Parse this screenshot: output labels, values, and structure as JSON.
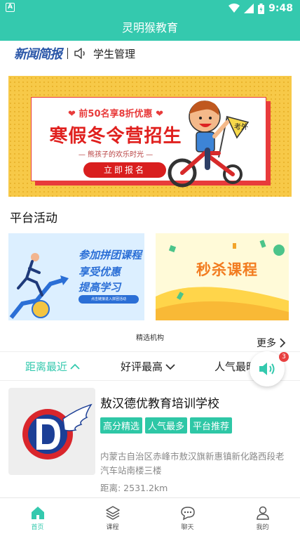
{
  "status_bar": {
    "notification_icon_letter": "A",
    "time": "9:48"
  },
  "app_bar": {
    "title": "灵明猴教育"
  },
  "news": {
    "logo_text": "新闻简报",
    "message": "学生管理"
  },
  "banner": {
    "discount": "❤ 前50名享8折优惠 ❤",
    "title": "寒假冬令营招生",
    "subtitle": "— 熊孩子的欢乐时光 —",
    "button": "立即报名",
    "flag_text": "考外"
  },
  "platform_activity": {
    "title": "平台活动",
    "promo_group": {
      "line1": "参加拼团课程",
      "line2": "享受优惠",
      "line3": "提高学习",
      "line4": "点击链接进入拼团活动"
    },
    "promo_flash": {
      "title": "秒杀课程"
    }
  },
  "featured": {
    "label": "精选机构",
    "more": "更多"
  },
  "filters": [
    {
      "label": "距离最近",
      "active": true
    },
    {
      "label": "好评最高",
      "active": false
    },
    {
      "label": "人气最旺",
      "active": false
    }
  ],
  "float_audio": {
    "badge": "3"
  },
  "school": {
    "name": "敖汉德优教育培训学校",
    "tags": [
      "高分精选",
      "人气最多",
      "平台推荐"
    ],
    "address": "内蒙古自治区赤峰市敖汉旗新惠镇新化路西段老汽车站南楼三楼",
    "distance": "距离: 2531.2km"
  },
  "bottom_nav": [
    {
      "label": "首页",
      "icon": "home-icon",
      "active": true
    },
    {
      "label": "课程",
      "icon": "layers-icon",
      "active": false
    },
    {
      "label": "聊天",
      "icon": "chat-icon",
      "active": false
    },
    {
      "label": "我的",
      "icon": "person-icon",
      "active": false
    }
  ],
  "colors": {
    "primary": "#34c9ae",
    "tag": "#2ec7a6",
    "banner_red": "#e0201e",
    "banner_yellow": "#f7c948"
  }
}
